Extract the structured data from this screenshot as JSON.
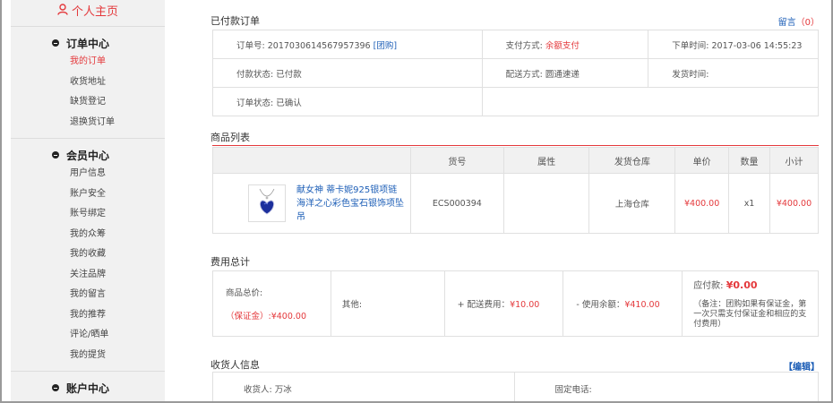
{
  "sidebar": {
    "top_label": "个人主页",
    "sections": [
      {
        "title": "订单中心",
        "items": [
          "我的订单",
          "收货地址",
          "缺货登记",
          "退换货订单"
        ]
      },
      {
        "title": "会员中心",
        "items": [
          "用户信息",
          "账户安全",
          "账号绑定",
          "我的众筹",
          "我的收藏",
          "关注品牌",
          "我的留言",
          "我的推荐",
          "评论/晒单",
          "我的提货"
        ]
      },
      {
        "title": "账户中心",
        "items": []
      }
    ]
  },
  "order": {
    "heading": "已付款订单",
    "message_label": "留言",
    "message_count": "（0）",
    "sn_label": "订单号:",
    "sn_value": "2017030614567957396",
    "group_tag": "[团购]",
    "pay_method_label": "支付方式:",
    "pay_method_value": "余额支付",
    "order_time_label": "下单时间:",
    "order_time_value": "2017-03-06 14:55:23",
    "pay_status_label": "付款状态:",
    "pay_status_value": "已付款",
    "shipping_label": "配送方式:",
    "shipping_value": "圆通速递",
    "ship_time_label": "发货时间:",
    "ship_time_value": "",
    "order_status_label": "订单状态:",
    "order_status_value": "已确认"
  },
  "goods": {
    "heading": "商品列表",
    "headers": [
      "",
      "货号",
      "属性",
      "发货仓库",
      "单价",
      "数量",
      "小计"
    ],
    "rows": [
      {
        "name": "献女神 蒂卡妮925银项链 海洋之心彩色宝石银饰项坠吊",
        "sn": "ECS000394",
        "attr": "",
        "warehouse": "上海仓库",
        "price": "¥400.00",
        "qty": "x1",
        "subtotal": "¥400.00"
      }
    ]
  },
  "fees": {
    "heading": "费用总计",
    "goods_total_label": "商品总价:",
    "deposit_text": "（保证金）:¥400.00",
    "other_label": "其他:",
    "shipping_fee_text": "+ 配送费用：",
    "shipping_fee_value": "¥10.00",
    "balance_text": "- 使用余额：",
    "balance_value": "¥410.00",
    "due_label": "应付款:",
    "due_value": "¥0.00",
    "note": "（备注：团购如果有保证金，第一次只需支付保证金和相应的支付费用）"
  },
  "receiver": {
    "heading": "收货人信息",
    "edit_label": "【编辑】",
    "name_label": "收货人:",
    "name_value": "万冰",
    "phone_label": "固定电话:",
    "phone_value": ""
  },
  "colors": {
    "accent": "#e4393c",
    "link": "#1e5fb7"
  }
}
